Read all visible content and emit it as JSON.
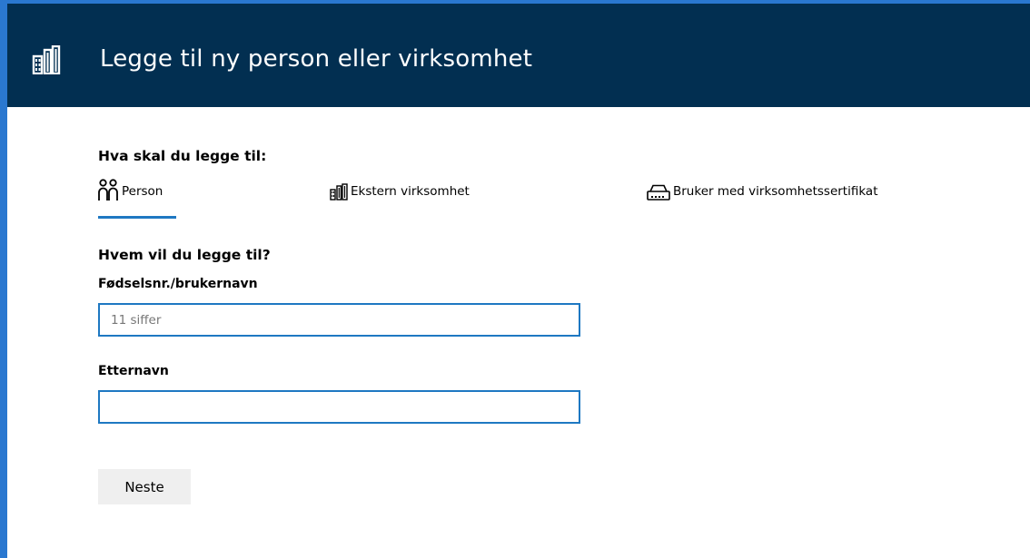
{
  "header": {
    "title": "Legge til ny person eller virksomhet",
    "logo_icon": "building-icon",
    "background_color": "#022f51"
  },
  "type_section": {
    "heading": "Hva skal du legge til:",
    "tabs": [
      {
        "label": "Person",
        "icon": "person-icon",
        "selected": true
      },
      {
        "label": "Ekstern virksomhet",
        "icon": "building-icon",
        "selected": false
      },
      {
        "label": "Bruker med virksomhetssertifikat",
        "icon": "certificate-device-icon",
        "selected": false
      }
    ]
  },
  "form": {
    "heading": "Hvem vil du legge til?",
    "id_field": {
      "label": "Fødselsnr./brukernavn",
      "placeholder": "11 siffer",
      "value": ""
    },
    "lastname_field": {
      "label": "Etternavn",
      "placeholder": "",
      "value": ""
    },
    "next_button": "Neste"
  },
  "colors": {
    "accent": "#1e78c2",
    "frame": "#2a78d0"
  }
}
